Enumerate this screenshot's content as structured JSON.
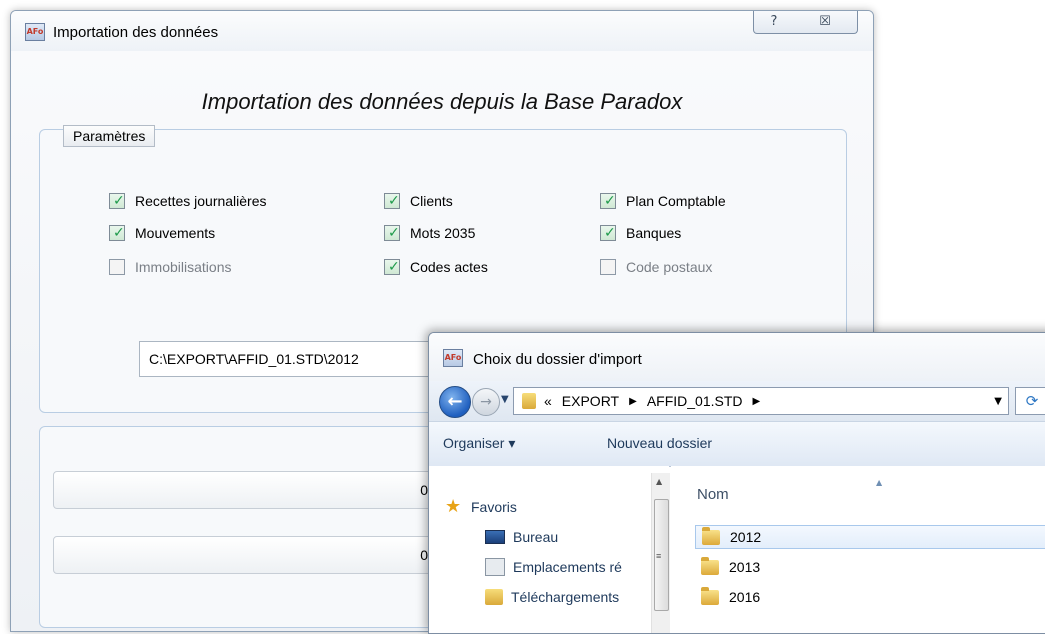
{
  "main_window": {
    "title": "Importation des données",
    "help_glyph": "?",
    "close_glyph": "☒",
    "heading": "Importation des données depuis la Base Paradox",
    "params_legend": "Paramètres",
    "checkboxes": [
      {
        "label": "Recettes journalières",
        "checked": true,
        "enabled": true
      },
      {
        "label": "Clients",
        "checked": true,
        "enabled": true
      },
      {
        "label": "Plan Comptable",
        "checked": true,
        "enabled": true
      },
      {
        "label": "Mouvements",
        "checked": true,
        "enabled": true
      },
      {
        "label": "Mots 2035",
        "checked": true,
        "enabled": true
      },
      {
        "label": "Banques",
        "checked": true,
        "enabled": true
      },
      {
        "label": "Immobilisations",
        "checked": false,
        "enabled": false
      },
      {
        "label": "Codes actes",
        "checked": true,
        "enabled": true
      },
      {
        "label": "Code postaux",
        "checked": false,
        "enabled": false
      }
    ],
    "path_value": "C:\\EXPORT\\AFFID_01.STD\\2012",
    "progress": [
      {
        "value_text": "0",
        "fraction": 0
      },
      {
        "value_text": "0",
        "fraction": 0
      }
    ]
  },
  "dialog": {
    "title": "Choix du dossier d'import",
    "breadcrumbs": [
      "«",
      "EXPORT",
      "AFFID_01.STD"
    ],
    "organiser_label": "Organiser ▾",
    "new_folder_label": "Nouveau dossier",
    "nav_items": [
      "Favoris",
      "Bureau",
      "Emplacements ré",
      "Téléchargements"
    ],
    "column_header": "Nom",
    "folders": [
      "2012",
      "2013",
      "2016"
    ],
    "selected_folder": "2012"
  },
  "colors": {
    "accent_blue": "#1f5fbf",
    "check_green": "#1e9a4a",
    "selection_border": "#a8c8ec"
  },
  "icons": {
    "app": "affid-app-icon",
    "back": "back-arrow-icon",
    "forward": "forward-arrow-icon",
    "folder": "folder-icon",
    "favorites": "star-icon",
    "desktop": "desktop-icon",
    "recent": "recent-places-icon",
    "downloads": "downloads-icon",
    "refresh": "refresh-icon"
  }
}
